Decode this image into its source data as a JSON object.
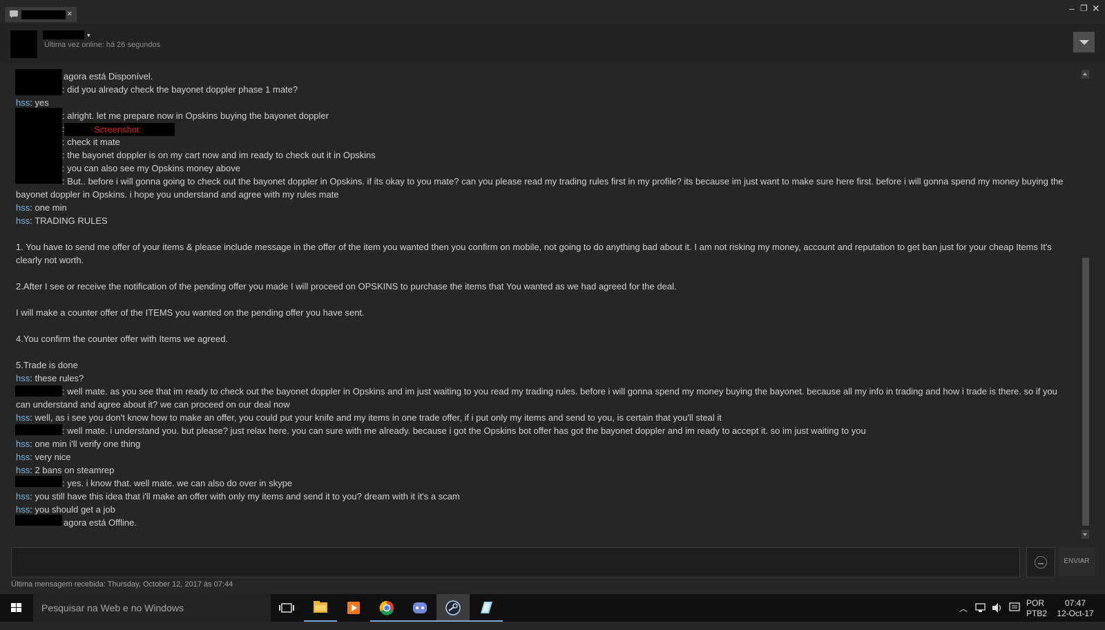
{
  "window": {
    "tab_close": "×",
    "min": "–",
    "max": "❐",
    "close": "✕"
  },
  "header": {
    "caret": "▾",
    "last_online": "Última vez online: há 26 segundos"
  },
  "messages": [
    {
      "who": "",
      "text": "agora está Disponível."
    },
    {
      "who": "",
      "text": ": did you already check the bayonet doppler phase 1 mate?"
    },
    {
      "who": "hss",
      "text": ": yes"
    },
    {
      "who": "",
      "text": ": alright. let me prepare now in Opskins buying the bayonet doppler"
    },
    {
      "who": "",
      "text": ":"
    },
    {
      "who": "",
      "text": ": check it mate"
    },
    {
      "who": "",
      "text": ": the bayonet doppler is on my cart now and im ready to check out it in Opskins"
    },
    {
      "who": "",
      "text": ": you can also see my Opskins money above"
    },
    {
      "who": "",
      "text": ": But.. before i will gonna going to check out the bayonet doppler in Opskins. if its okay to you mate? can you please read my trading rules first in my profile? its because im just want to make sure here first. before i will gonna spend my money buying the bayonet doppler in Opskins. i hope you understand and agree with my rules mate"
    },
    {
      "who": "hss",
      "text": ": one min"
    },
    {
      "who": "hss",
      "text": ": TRADING RULES"
    },
    {
      "who": "",
      "text": "  1. You have to send me offer of your items & please include message in the offer of the item you wanted then you confirm on mobile, not going to do anything bad about it. I am not risking my money, account and reputation to get ban just for your cheap Items It's clearly not worth."
    },
    {
      "who": "",
      "text": " 2.After I see or receive the notification of the pending offer you made I will proceed on OPSKINS to purchase the items that You wanted as we had agreed for the deal."
    },
    {
      "who": "",
      "text": " I will make a counter offer of the ITEMS you wanted on the pending offer you have sent."
    },
    {
      "who": "",
      "text": " 4.You confirm the counter offer with Items we agreed."
    },
    {
      "who": "",
      "text": " 5.Trade is done"
    },
    {
      "who": "hss",
      "text": ": these rules?"
    },
    {
      "who": "",
      "text": ": well mate. as you see that im ready to check out the bayonet doppler in Opskins and im just waiting to you read my trading rules. before i will gonna spend my money buying the bayonet. because all my info in trading and how i trade is there. so if you can understand and agree about it? we can proceed on our deal now"
    },
    {
      "who": "hss",
      "text": ": well, as i see you don't know how to make an offer, you could put your knife and my items in one trade offer, if i put only my items and send to you, is certain that you'll steal it"
    },
    {
      "who": "",
      "text": ": well mate. i understand you. but please? just relax here. you can sure with me already. because i got the Opskins bot offer has got the bayonet doppler and im ready to accept it. so im just waiting to you"
    },
    {
      "who": "hss",
      "text": ": one min i'll verify one thing"
    },
    {
      "who": "hss",
      "text": ": very nice"
    },
    {
      "who": "hss",
      "text": ": 2 bans on steamrep"
    },
    {
      "who": "",
      "text": ": yes. i know that. well mate. we can also do over in skype"
    },
    {
      "who": "hss",
      "text": ": you still have this idea that i'll make an offer with only my items and send it to you? dream with it it's a scam"
    },
    {
      "who": "hss",
      "text": ": you should get a job"
    },
    {
      "who": "",
      "text": "agora está Offline."
    }
  ],
  "screenshot_label": "Screenshot",
  "input": {
    "value": "",
    "placeholder": ""
  },
  "send_label": "ENVIAR",
  "last_message": "Última mensagem recebida: Thursday, October 12, 2017 às 07:44",
  "taskbar": {
    "search_placeholder": "Pesquisar na Web e no Windows",
    "lang": "POR",
    "layout": "PTB2",
    "time": "07:47",
    "date": "12-Oct-17"
  }
}
